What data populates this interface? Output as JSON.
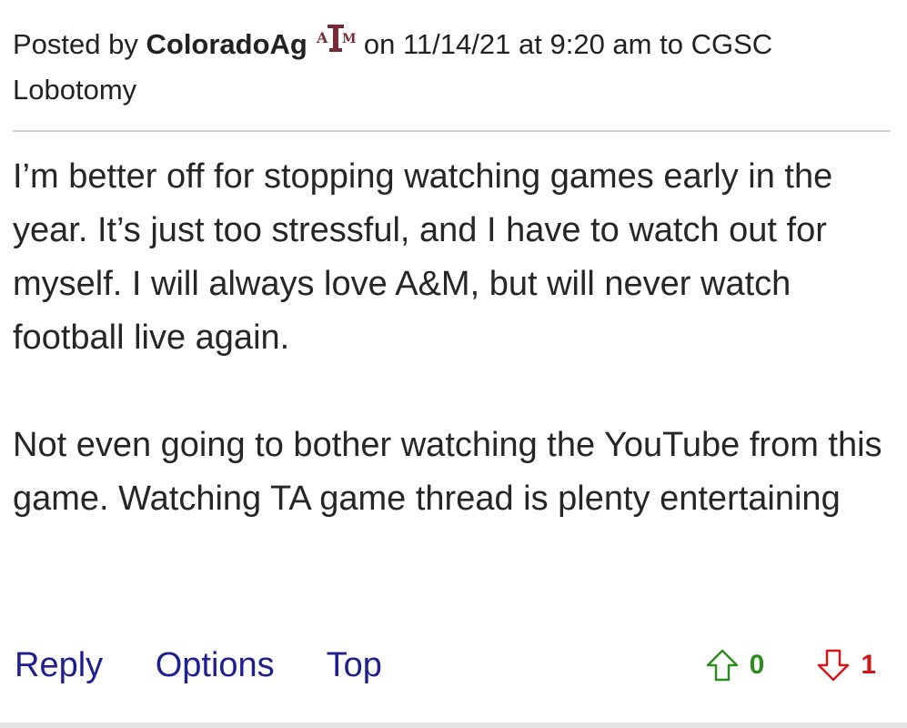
{
  "post": {
    "posted_by_label": "Posted by",
    "author": "ColoradoAg",
    "logo": {
      "icon": "texas-am-logo-icon",
      "text": "ATM",
      "color": "#7a2a36"
    },
    "date_prefix": "on",
    "date": "11/14/21",
    "time_prefix": "at",
    "time": "9:20 am",
    "to_label": "to",
    "recipient": "CGSC Lobotomy",
    "body": [
      "I’m better off for stopping watching games early in the year. It’s just too stressful, and I have to watch out for myself. I will always love A&M, but will never watch football live again.",
      "Not even going to bother watching the YouTube from this game. Watching TA game thread is plenty entertaining"
    ]
  },
  "actions": {
    "reply_label": "Reply",
    "options_label": "Options",
    "top_label": "Top",
    "link_color": "#1f1f8f"
  },
  "votes": {
    "up": {
      "icon": "arrow-up-outline-icon",
      "count": "0",
      "color": "#2e8b20"
    },
    "down": {
      "icon": "arrow-down-outline-icon",
      "count": "1",
      "color": "#d01818"
    }
  }
}
